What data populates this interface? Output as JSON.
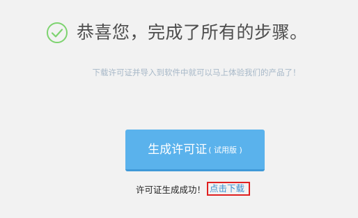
{
  "header": {
    "icon": "check-circle-icon",
    "title": "恭喜您，完成了所有的步骤。"
  },
  "subtitle": "下载许可证并导入到软件中就可以马上体验我们的产品了！",
  "generate_button": {
    "label": "生成许可证",
    "sub_label": "( 试用版 )"
  },
  "status": {
    "message": "许可证生成成功！",
    "download_label": "点击下载"
  },
  "colors": {
    "background": "#f2f2f2",
    "accent": "#5ab2ec",
    "success_green": "#7dd36f",
    "link": "#3a8fd0",
    "highlight_border": "#e02020"
  }
}
